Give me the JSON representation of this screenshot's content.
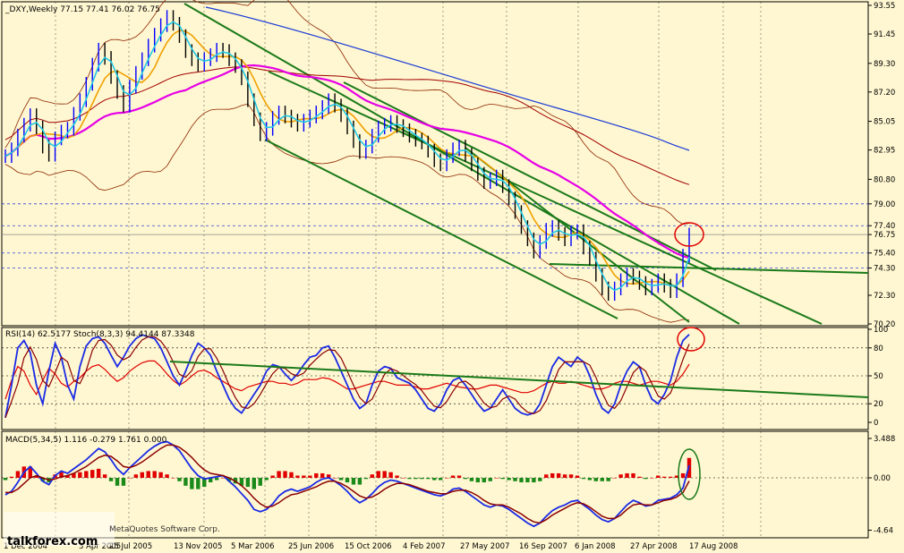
{
  "chart_data": [
    {
      "type": "line",
      "title": "_DXY,Weekly  77.15 77.41 76.02 76.75",
      "y_ticks": [
        "93.55",
        "91.45",
        "89.30",
        "87.20",
        "85.05",
        "82.95",
        "80.80",
        "79.00",
        "77.40",
        "76.75",
        "75.40",
        "74.30",
        "72.30",
        "70.20"
      ],
      "tick_values": [
        93.55,
        91.45,
        89.3,
        87.2,
        85.05,
        82.95,
        80.8,
        79.0,
        77.4,
        76.75,
        75.4,
        74.3,
        72.3,
        70.2
      ],
      "highlighted_levels": [
        "79.00",
        "77.40",
        "76.75",
        "75.40",
        "74.30"
      ],
      "ylim": [
        70.2,
        93.55
      ],
      "x_ticks": [
        "1 Dec 2004",
        "3 Apr 2005",
        "25 Jul 2005",
        "13 Nov 2005",
        "5 Mar 2006",
        "25 Jun 2006",
        "15 Oct 2006",
        "4 Feb 2007",
        "27 May 2007",
        "16 Sep 2007",
        "6 Jan 2008",
        "27 Apr 2008",
        "17 Aug 2008"
      ],
      "series": [
        {
          "values": [
            82.5,
            83,
            84,
            84.8,
            85.5,
            84.6,
            83.2,
            82.6,
            83.8,
            84.3,
            84.5,
            85.6,
            86.6,
            87.8,
            89.2,
            90.3,
            89.7,
            88.3,
            87.2,
            86.2,
            87.6,
            88.6,
            89.6,
            90.6,
            91.4,
            92.1,
            92.7,
            92.2,
            91.3,
            90.2,
            89.6,
            89.2,
            89.6,
            89.9,
            90.3,
            90.2,
            89.6,
            89.1,
            88.2,
            86.6,
            85.2,
            84.1,
            84.5,
            85.3,
            85.7,
            85.4,
            85.1,
            84.8,
            85.1,
            85.4,
            85.7,
            86.1,
            86.6,
            86.2,
            85.5,
            84.6,
            83.6,
            82.8,
            83.2,
            84.0,
            84.6,
            84.8,
            85.0,
            84.7,
            84.4,
            84.0,
            83.7,
            83.5,
            82.9,
            82.2,
            81.9,
            82.5,
            83.0,
            83.2,
            82.6,
            81.9,
            81.2,
            80.6,
            80.8,
            81.0,
            80.3,
            79.4,
            78.4,
            77.3,
            76.4,
            75.5,
            76.2,
            77.1,
            77.3,
            76.8,
            76.4,
            76.9,
            77.0,
            75.8,
            75.0,
            73.8,
            72.8,
            72.4,
            72.8,
            73.4,
            73.8,
            73.6,
            73.2,
            72.8,
            73.0,
            73.4,
            73.0,
            72.6,
            73.4,
            75.2,
            76.75
          ]
        }
      ]
    },
    {
      "type": "line",
      "title": "RSI(14) 62.5177  Stoch(8,3,3) 94.4144 87.3348",
      "y_ticks": [
        "100",
        "80",
        "50",
        "20",
        "0"
      ],
      "tick_values": [
        100,
        80,
        50,
        20,
        0
      ],
      "ylim": [
        0,
        100
      ],
      "series": [
        {
          "values": [
            25,
            45,
            60,
            55,
            40,
            30,
            45,
            58,
            52,
            42,
            38,
            44,
            48,
            55,
            60,
            62,
            57,
            50,
            44,
            48,
            55,
            60,
            64,
            66,
            66,
            60,
            52,
            45,
            40,
            44,
            50,
            55,
            56,
            53,
            48,
            44,
            40,
            36,
            34,
            38,
            40,
            42,
            44,
            44,
            42,
            42,
            40,
            42,
            46,
            46,
            46,
            48,
            47,
            44,
            40,
            36,
            36,
            38,
            40,
            42,
            44,
            44,
            42,
            40,
            40,
            40,
            38,
            36,
            36,
            38,
            40,
            42,
            40,
            38,
            37,
            36,
            36,
            38,
            40,
            40,
            38,
            36,
            34,
            32,
            32,
            34,
            38,
            42,
            44,
            42,
            42,
            44,
            42,
            40,
            38,
            36,
            36,
            38,
            42,
            44,
            44,
            42,
            40,
            42,
            44,
            44,
            42,
            40,
            44,
            52,
            62.5
          ]
        },
        {
          "values": [
            5,
            40,
            80,
            88,
            75,
            40,
            20,
            55,
            85,
            70,
            40,
            25,
            60,
            82,
            90,
            92,
            85,
            72,
            60,
            70,
            82,
            90,
            94,
            92,
            90,
            80,
            65,
            50,
            40,
            55,
            72,
            85,
            80,
            72,
            55,
            40,
            25,
            15,
            10,
            20,
            30,
            40,
            55,
            62,
            60,
            52,
            45,
            52,
            62,
            70,
            72,
            80,
            82,
            70,
            55,
            40,
            25,
            15,
            20,
            40,
            55,
            60,
            58,
            48,
            45,
            42,
            35,
            25,
            15,
            12,
            20,
            35,
            45,
            48,
            40,
            30,
            20,
            12,
            15,
            25,
            35,
            25,
            15,
            10,
            8,
            10,
            20,
            40,
            60,
            70,
            65,
            60,
            70,
            65,
            50,
            30,
            15,
            10,
            20,
            40,
            55,
            65,
            60,
            40,
            25,
            20,
            30,
            45,
            70,
            88,
            94.4
          ]
        }
      ]
    },
    {
      "type": "bar",
      "title": "MACD(5,34,5) 1.116 -0.279 1.761 0.000",
      "y_ticks": [
        "3.488",
        "0.00",
        "-4.64"
      ],
      "tick_values": [
        3.488,
        0,
        -4.64
      ],
      "ylim": [
        -4.64,
        3.488
      ],
      "series": [
        {
          "values": [
            -1.5,
            -1.2,
            -0.4,
            0.5,
            1.0,
            0.4,
            -0.3,
            -0.6,
            0.2,
            0.6,
            0.4,
            0.8,
            1.2,
            1.6,
            2.1,
            2.6,
            2.3,
            1.6,
            0.8,
            0.3,
            0.9,
            1.4,
            1.9,
            2.4,
            2.8,
            3.1,
            3.2,
            2.9,
            2.4,
            1.6,
            0.8,
            0.2,
            -0.1,
            0.0,
            0.1,
            0.2,
            -0.3,
            -0.8,
            -1.4,
            -2.0,
            -2.8,
            -3.0,
            -2.8,
            -2.3,
            -1.6,
            -1.2,
            -1.0,
            -1.2,
            -1.0,
            -0.8,
            -0.4,
            -0.1,
            0.0,
            -0.3,
            -0.7,
            -1.2,
            -1.8,
            -2.2,
            -1.9,
            -1.4,
            -0.8,
            -0.4,
            -0.2,
            -0.3,
            -0.5,
            -0.7,
            -0.9,
            -1.1,
            -1.3,
            -1.5,
            -1.6,
            -1.4,
            -1.0,
            -0.9,
            -1.2,
            -1.6,
            -2.0,
            -2.4,
            -2.6,
            -2.4,
            -2.5,
            -2.8,
            -3.2,
            -3.6,
            -4.0,
            -4.3,
            -4.0,
            -3.4,
            -2.9,
            -2.6,
            -2.4,
            -2.1,
            -2.0,
            -2.4,
            -2.8,
            -3.3,
            -3.7,
            -3.9,
            -3.6,
            -3.0,
            -2.4,
            -2.0,
            -2.2,
            -2.5,
            -2.4,
            -2.0,
            -1.9,
            -1.8,
            -1.5,
            -0.9,
            1.116
          ]
        },
        {
          "values": [
            -1.3,
            -1.3,
            -1.0,
            -0.5,
            0.0,
            0.2,
            0.0,
            -0.2,
            -0.1,
            0.1,
            0.2,
            0.4,
            0.7,
            1.0,
            1.4,
            1.8,
            2.0,
            1.9,
            1.5,
            1.0,
            0.9,
            1.1,
            1.4,
            1.8,
            2.2,
            2.6,
            2.9,
            2.9,
            2.7,
            2.3,
            1.8,
            1.2,
            0.7,
            0.4,
            0.3,
            0.2,
            0.0,
            -0.3,
            -0.7,
            -1.2,
            -1.8,
            -2.3,
            -2.6,
            -2.5,
            -2.2,
            -1.8,
            -1.5,
            -1.4,
            -1.2,
            -1.0,
            -0.8,
            -0.5,
            -0.3,
            -0.3,
            -0.5,
            -0.8,
            -1.2,
            -1.6,
            -1.8,
            -1.7,
            -1.4,
            -1.0,
            -0.7,
            -0.5,
            -0.5,
            -0.6,
            -0.8,
            -1.0,
            -1.2,
            -1.3,
            -1.4,
            -1.4,
            -1.2,
            -1.1,
            -1.1,
            -1.3,
            -1.6,
            -2.0,
            -2.3,
            -2.4,
            -2.4,
            -2.6,
            -2.9,
            -3.2,
            -3.6,
            -3.9,
            -4.0,
            -3.7,
            -3.3,
            -3.0,
            -2.7,
            -2.4,
            -2.2,
            -2.3,
            -2.6,
            -3.0,
            -3.4,
            -3.6,
            -3.6,
            -3.3,
            -2.8,
            -2.4,
            -2.3,
            -2.4,
            -2.4,
            -2.2,
            -2.0,
            -1.9,
            -1.7,
            -1.3,
            -0.279
          ]
        },
        {
          "values": [
            -0.2,
            0.1,
            0.6,
            1.0,
            1.0,
            0.2,
            -0.3,
            -0.4,
            0.3,
            0.5,
            0.2,
            0.4,
            0.5,
            0.6,
            0.7,
            0.8,
            0.3,
            -0.3,
            -0.7,
            -0.7,
            0.0,
            0.3,
            0.5,
            0.6,
            0.6,
            0.5,
            0.3,
            0.0,
            -0.3,
            -0.7,
            -1.0,
            -1.0,
            -0.8,
            -0.4,
            -0.2,
            0.0,
            -0.3,
            -0.5,
            -0.7,
            -0.8,
            -1.0,
            -0.7,
            -0.2,
            0.2,
            0.6,
            0.6,
            0.5,
            0.2,
            0.2,
            0.2,
            0.4,
            0.4,
            0.3,
            0.0,
            -0.2,
            -0.4,
            -0.6,
            -0.6,
            -0.1,
            0.3,
            0.6,
            0.6,
            0.5,
            0.2,
            0.0,
            -0.1,
            -0.1,
            -0.1,
            -0.1,
            -0.2,
            -0.2,
            0.0,
            0.2,
            0.2,
            -0.1,
            -0.3,
            -0.4,
            -0.4,
            -0.3,
            0.0,
            -0.1,
            -0.2,
            -0.3,
            -0.4,
            -0.4,
            -0.4,
            -0.3,
            0.3,
            0.4,
            0.4,
            0.3,
            0.3,
            0.2,
            -0.1,
            -0.2,
            -0.3,
            -0.3,
            -0.3,
            0.0,
            0.3,
            0.4,
            0.4,
            0.1,
            -0.1,
            0.0,
            0.2,
            0.1,
            0.1,
            0.2,
            0.4,
            1.761
          ]
        }
      ]
    }
  ],
  "footer": {
    "watermark_text": "MetaQuotes Software Corp.",
    "logo_text": "talkforex.com"
  },
  "colors": {
    "background": "#fff7d1",
    "price_up": "#0000ff",
    "price_down": "#000000",
    "cyan_ma": "#22c8e6",
    "orange_ma": "#f0a000",
    "magenta_ma": "#e600e6",
    "red_ma": "#a00000",
    "blue_ma": "#1a3cd6",
    "channel": "#1a7a1a",
    "bands": "#8b2500",
    "highlight_circle_red": "#e00000",
    "highlight_circle_green": "#1a7a1a"
  }
}
